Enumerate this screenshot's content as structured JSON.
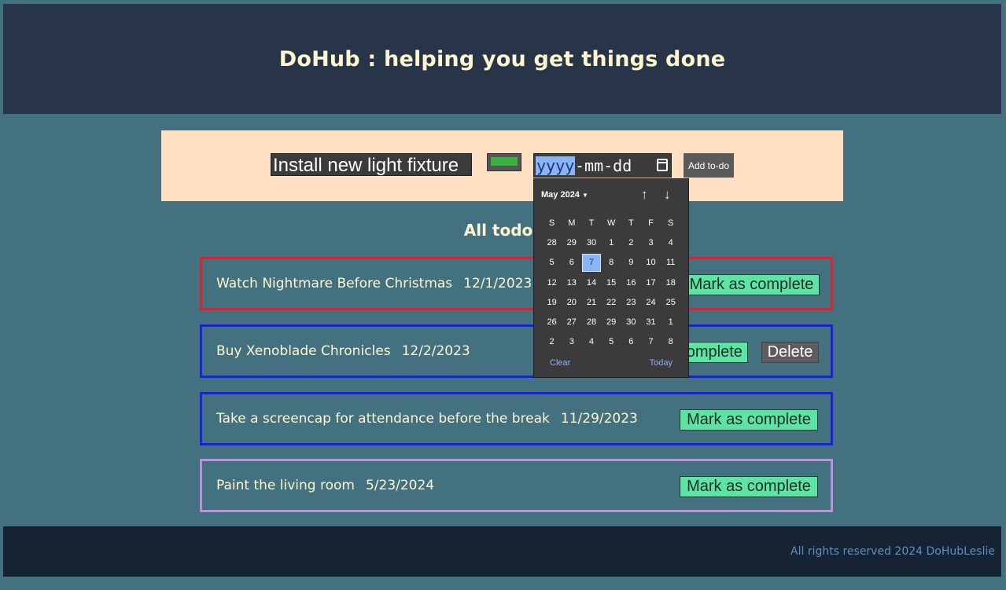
{
  "header": {
    "title": "DoHub : helping you get things done"
  },
  "form": {
    "todo_input_value": "Install new light fixture",
    "color_value": "#3bb043",
    "date_segment_year": "yyyy",
    "date_segment_rest": "-mm-dd",
    "add_button_label": "Add to-do"
  },
  "list": {
    "title": "All todos",
    "items": [
      {
        "title": "Watch Nightmare Before Christmas",
        "due": "12/1/2023",
        "border_color": "#e0202a",
        "complete_label": "Mark as complete"
      },
      {
        "title": "Buy Xenoblade Chronicles",
        "due": "12/2/2023",
        "border_color": "#1a1ee6",
        "complete_label": "Mark as complete",
        "delete_label": "Delete"
      },
      {
        "title": "Take a screencap for attendance before the break",
        "due": "11/29/2023",
        "border_color": "#1a1ee6",
        "complete_label": "Mark as complete"
      },
      {
        "title": "Paint the living room",
        "due": "5/23/2024",
        "border_color": "#c090e0",
        "complete_label": "Mark as complete"
      }
    ]
  },
  "datepicker": {
    "month_label": "May 2024",
    "weekdays": [
      "S",
      "M",
      "T",
      "W",
      "T",
      "F",
      "S"
    ],
    "days": [
      "28",
      "29",
      "30",
      "1",
      "2",
      "3",
      "4",
      "5",
      "6",
      "7",
      "8",
      "9",
      "10",
      "11",
      "12",
      "13",
      "14",
      "15",
      "16",
      "17",
      "18",
      "19",
      "20",
      "21",
      "22",
      "23",
      "24",
      "25",
      "26",
      "27",
      "28",
      "29",
      "30",
      "31",
      "1",
      "2",
      "3",
      "4",
      "5",
      "6",
      "7",
      "8"
    ],
    "selected_day": "7",
    "clear_label": "Clear",
    "today_label": "Today"
  },
  "footer": {
    "copyright": "All rights reserved 2024 DoHubLeslie"
  }
}
